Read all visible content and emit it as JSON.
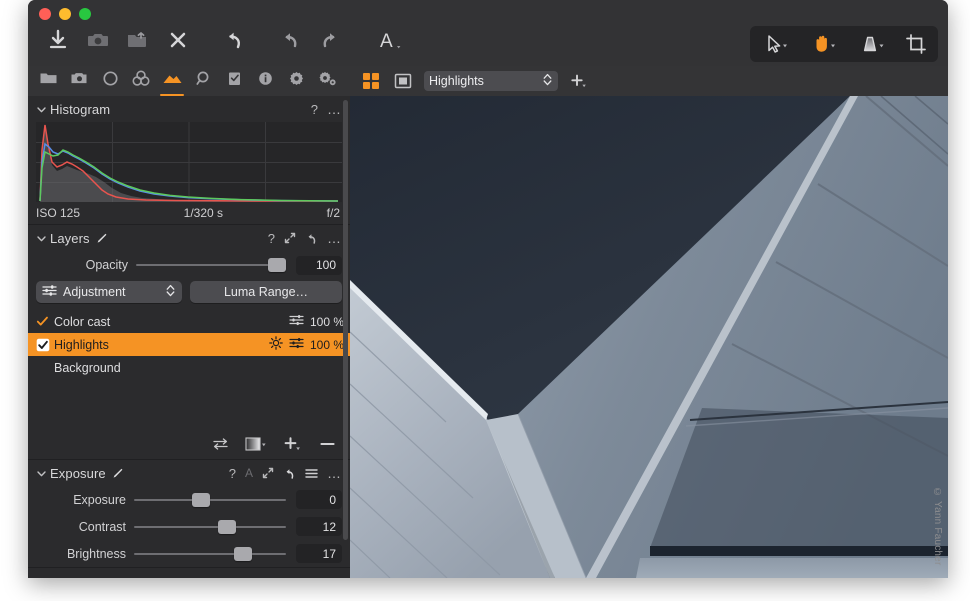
{
  "window": {
    "traffic_lights": [
      "close",
      "minimize",
      "zoom"
    ]
  },
  "toolbar": {
    "left_items": [
      {
        "name": "import-icon",
        "label": "Import"
      },
      {
        "name": "camera-icon",
        "label": "Tethered capture"
      },
      {
        "name": "export-icon",
        "label": "Export"
      },
      {
        "name": "delete-icon",
        "label": "Delete"
      },
      {
        "name": "reset-icon",
        "label": "Reset adjustments"
      },
      {
        "name": "undo-icon",
        "label": "Undo"
      },
      {
        "name": "redo-icon",
        "label": "Redo"
      },
      {
        "name": "annotate-icon",
        "label": "Annotation"
      }
    ],
    "right_items": [
      {
        "name": "cursor-tool-icon",
        "label": "Select",
        "active": false
      },
      {
        "name": "hand-tool-icon",
        "label": "Pan",
        "active": true
      },
      {
        "name": "gradient-tool-icon",
        "label": "Gradient mask",
        "active": false
      },
      {
        "name": "crop-tool-icon",
        "label": "Crop",
        "active": false
      }
    ]
  },
  "sidebar": {
    "tabs": [
      {
        "name": "tab-library",
        "icon": "folder-icon",
        "active": false
      },
      {
        "name": "tab-capture",
        "icon": "camera-icon",
        "active": false
      },
      {
        "name": "tab-lens",
        "icon": "circle-icon",
        "active": false
      },
      {
        "name": "tab-color",
        "icon": "color-wheels-icon",
        "active": false
      },
      {
        "name": "tab-exposure",
        "icon": "mountain-icon",
        "active": true
      },
      {
        "name": "tab-details",
        "icon": "magnifier-icon",
        "active": false
      },
      {
        "name": "tab-adjustments",
        "icon": "checklist-icon",
        "active": false
      },
      {
        "name": "tab-metadata",
        "icon": "info-icon",
        "active": false
      },
      {
        "name": "tab-output",
        "icon": "gear-icon",
        "active": false
      },
      {
        "name": "tab-batch",
        "icon": "gears-icon",
        "active": false
      }
    ],
    "histogram": {
      "title": "Histogram",
      "help_label": "?",
      "more_label": "…",
      "iso": "ISO 125",
      "shutter": "1/320 s",
      "aperture": "f/2"
    },
    "layers": {
      "title": "Layers",
      "help_label": "?",
      "more_label": "…",
      "opacity_label": "Opacity",
      "opacity_value": "100",
      "opacity_percent": 100,
      "mode_label": "Adjustment",
      "luma_label": "Luma Range…",
      "items": [
        {
          "name": "Color cast",
          "checked": true,
          "percent": "100 %",
          "selected": false,
          "has_sun": false
        },
        {
          "name": "Highlights",
          "checked": true,
          "percent": "100 %",
          "selected": true,
          "has_sun": true
        },
        {
          "name": "Background",
          "checked": null,
          "percent": "",
          "selected": false,
          "has_sun": false
        }
      ],
      "tools": [
        {
          "name": "invert-mask-icon"
        },
        {
          "name": "mask-display-icon"
        },
        {
          "name": "add-layer-icon"
        },
        {
          "name": "remove-layer-icon"
        }
      ]
    },
    "exposure": {
      "title": "Exposure",
      "help_label": "?",
      "auto_label": "A",
      "more_label": "…",
      "sliders": [
        {
          "label": "Exposure",
          "value": "0",
          "percent": 38
        },
        {
          "label": "Contrast",
          "value": "12",
          "percent": 55
        },
        {
          "label": "Brightness",
          "value": "17",
          "percent": 66
        }
      ]
    }
  },
  "viewer": {
    "grid_view_label": "Grid view",
    "single_view_label": "Single view",
    "layer_select_value": "Highlights",
    "add_label": "+",
    "copyright": "© Yann Faucher"
  },
  "colors": {
    "accent": "#f59324",
    "panel_bg": "#2b2b2d",
    "titlebar_bg": "#333335",
    "tabbar_bg": "#343436",
    "sky": "#2d3541",
    "panel_light": "#aeb6c0",
    "panel_mid": "#5a6774"
  }
}
